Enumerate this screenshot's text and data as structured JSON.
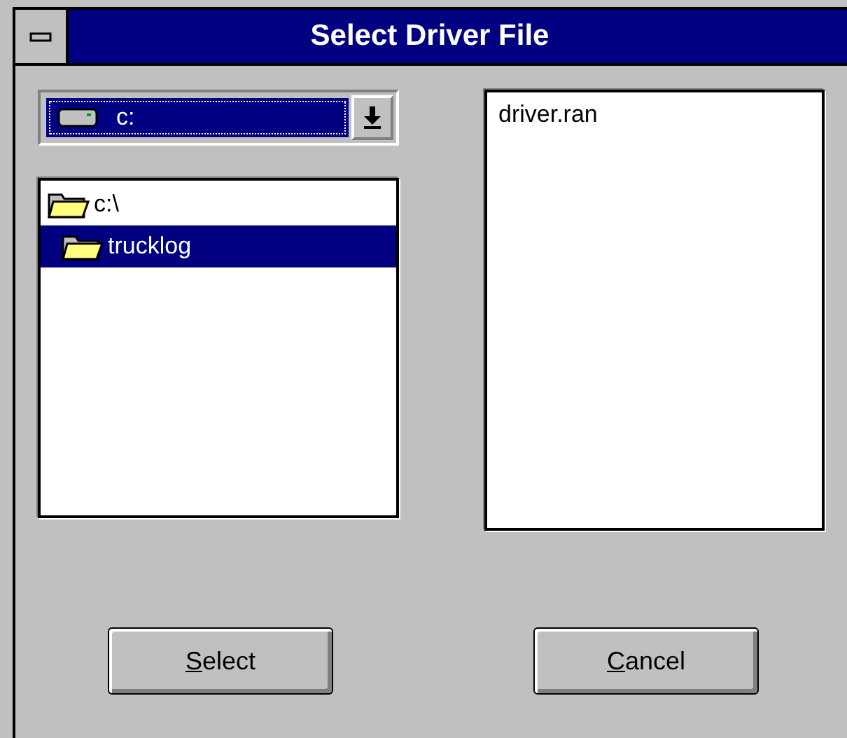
{
  "window": {
    "title": "Select Driver File"
  },
  "drive_combo": {
    "value": "c:"
  },
  "directories": [
    {
      "label": "c:\\",
      "selected": false,
      "children": [
        {
          "label": "trucklog",
          "selected": true
        }
      ]
    }
  ],
  "files": [
    {
      "label": "driver.ran",
      "selected": false
    }
  ],
  "buttons": [
    {
      "label": "Select"
    },
    {
      "label": "Cancel"
    }
  ]
}
